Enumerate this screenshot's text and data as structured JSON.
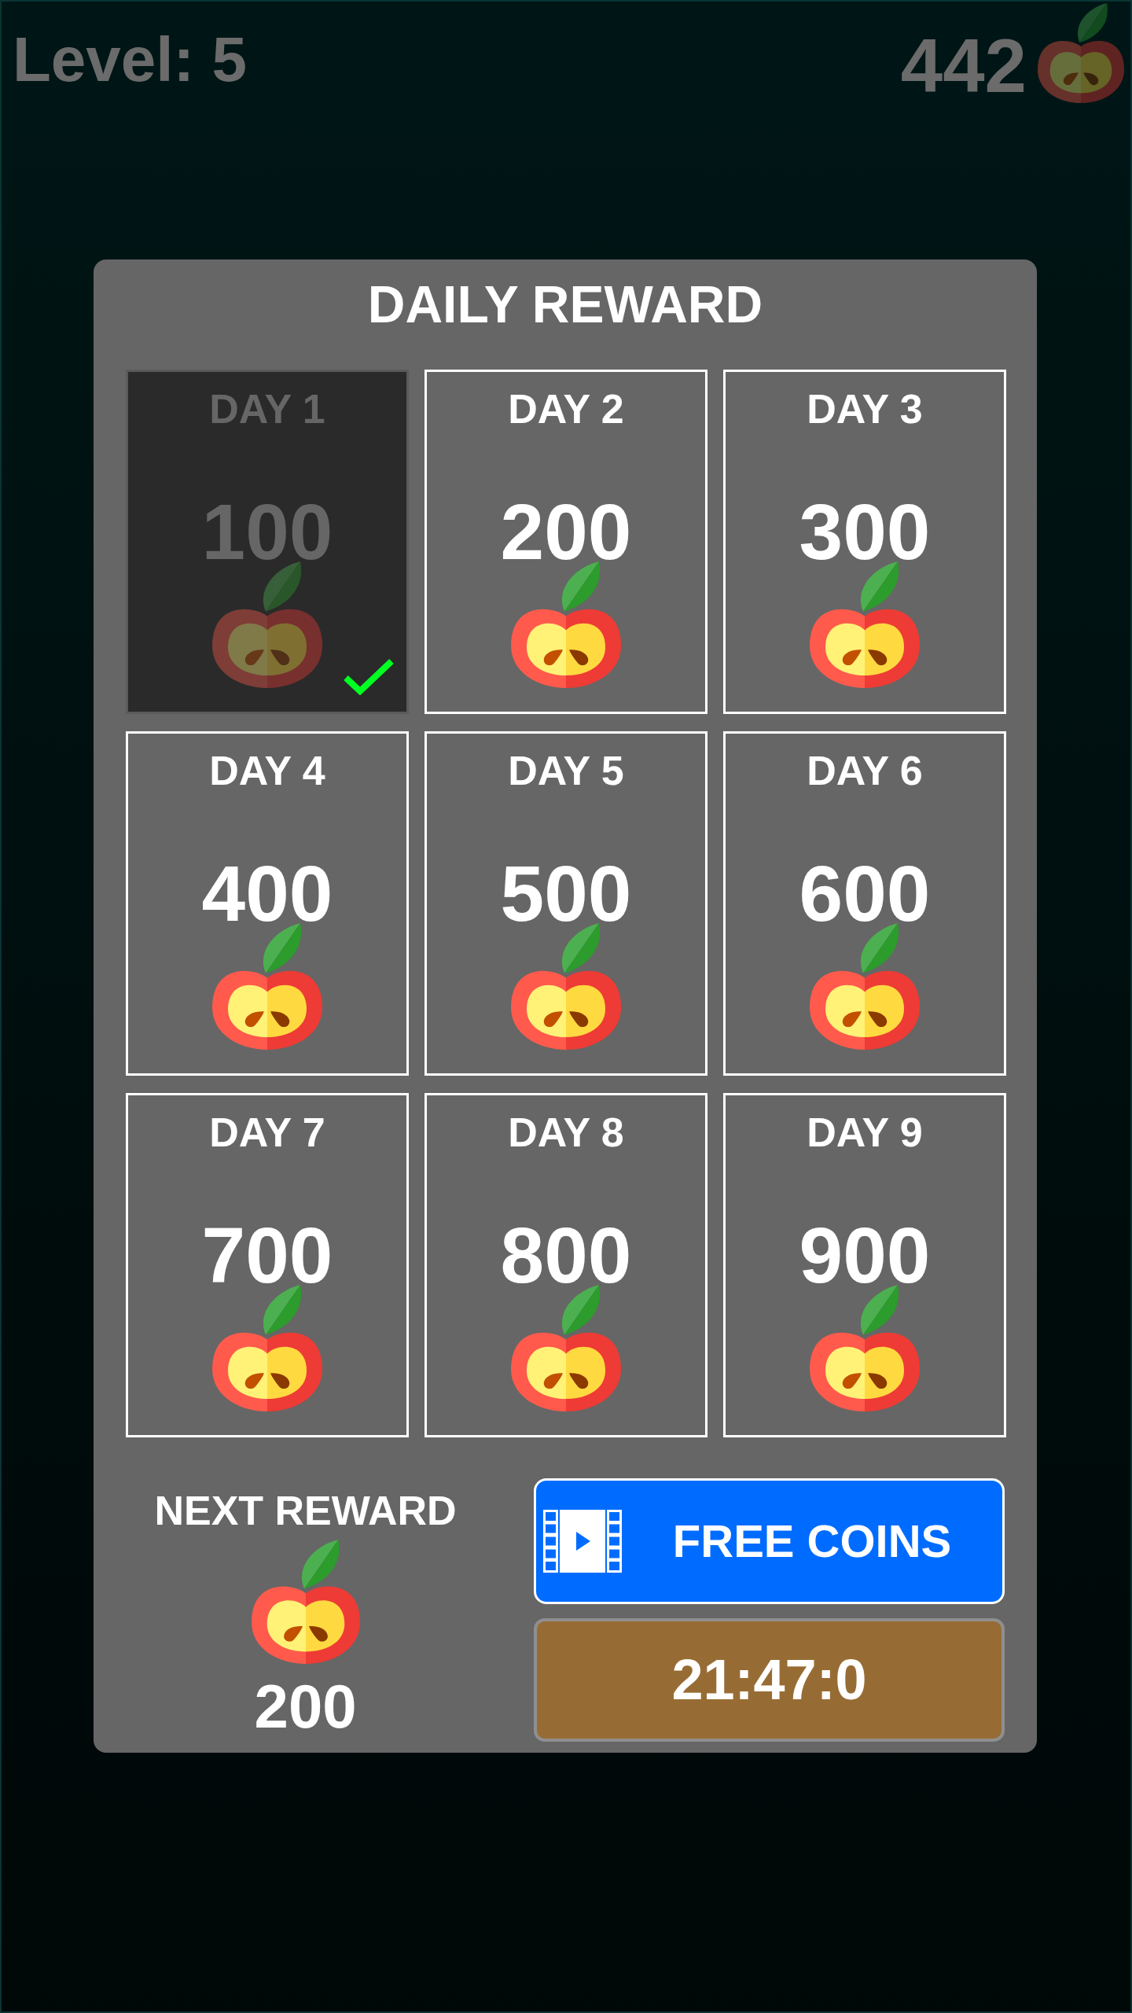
{
  "hud": {
    "level": "Level: 5",
    "coins": "442"
  },
  "dialog": {
    "title": "DAILY REWARD",
    "days": [
      {
        "label": "DAY 1",
        "amount": "100",
        "claimed": true
      },
      {
        "label": "DAY 2",
        "amount": "200",
        "claimed": false
      },
      {
        "label": "DAY 3",
        "amount": "300",
        "claimed": false
      },
      {
        "label": "DAY 4",
        "amount": "400",
        "claimed": false
      },
      {
        "label": "DAY 5",
        "amount": "500",
        "claimed": false
      },
      {
        "label": "DAY 6",
        "amount": "600",
        "claimed": false
      },
      {
        "label": "DAY 7",
        "amount": "700",
        "claimed": false
      },
      {
        "label": "DAY 8",
        "amount": "800",
        "claimed": false
      },
      {
        "label": "DAY 9",
        "amount": "900",
        "claimed": false
      }
    ],
    "next_reward": {
      "label": "NEXT REWARD",
      "amount": "200"
    },
    "free_coins_button": {
      "label": "FREE COINS"
    },
    "timer": {
      "label": "21:47:0"
    }
  }
}
